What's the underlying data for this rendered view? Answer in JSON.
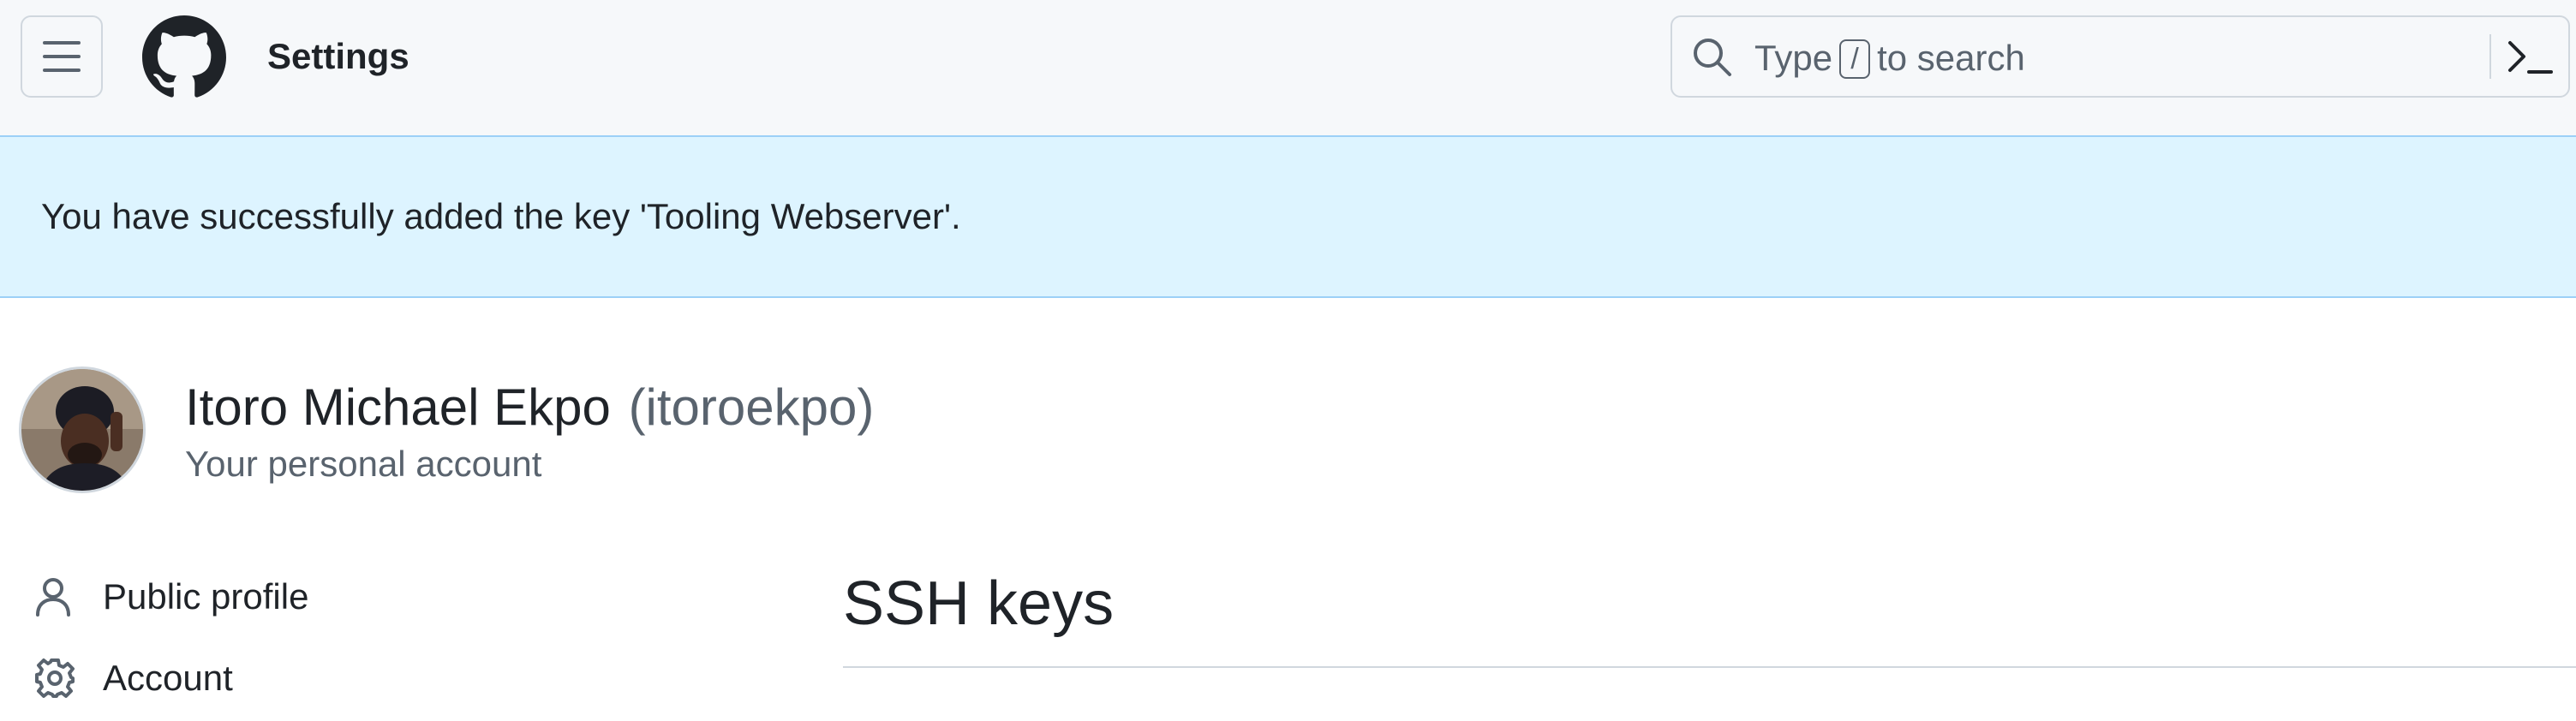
{
  "header": {
    "page_name": "Settings",
    "menu_icon": "hamburger-icon",
    "logo_icon": "github-mark-icon",
    "search": {
      "placeholder_before": "Type",
      "shortcut_key": "/",
      "placeholder_after": "to search",
      "search_icon": "search-icon",
      "command_icon": "command-palette-icon"
    }
  },
  "flash": {
    "message": "You have successfully added the key 'Tooling Webserver'.",
    "background": "#ddf4ff"
  },
  "account": {
    "name": "Itoro Michael Ekpo",
    "handle": "(itoroekpo)",
    "subtitle": "Your personal account"
  },
  "sidebar": {
    "items": [
      {
        "label": "Public profile",
        "icon": "person-icon"
      },
      {
        "label": "Account",
        "icon": "gear-icon"
      }
    ]
  },
  "main": {
    "title": "SSH keys"
  },
  "colors": {
    "header_bg": "#f6f8fa",
    "border": "#d0d7de",
    "text": "#1f2328",
    "muted": "#59636e",
    "flash_border": "#9cd0f7"
  }
}
